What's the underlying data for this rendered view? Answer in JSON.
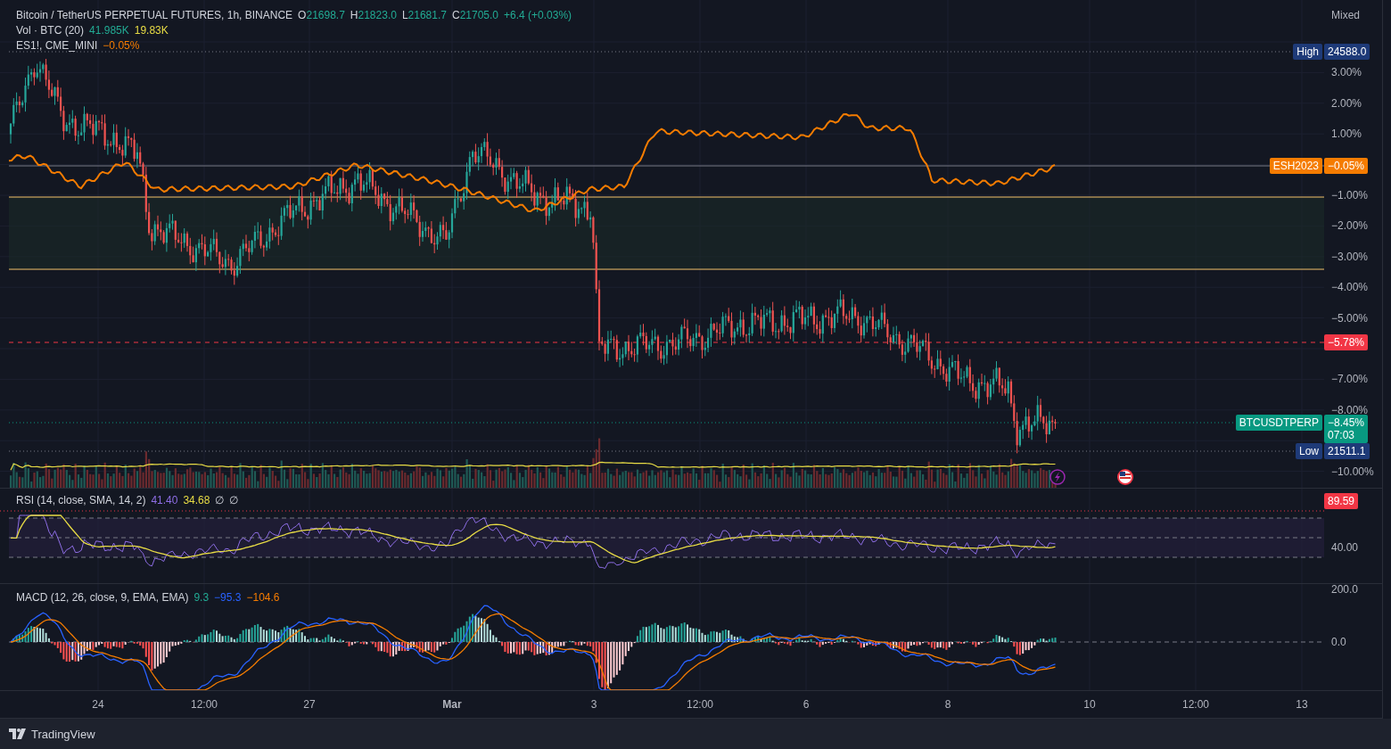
{
  "legend": {
    "symbol": "Bitcoin / TetherUS PERPETUAL FUTURES, 1h, BINANCE",
    "ohlc": [
      {
        "label": "O",
        "value": "21698.7"
      },
      {
        "label": "H",
        "value": "21823.0"
      },
      {
        "label": "L",
        "value": "21681.7"
      },
      {
        "label": "C",
        "value": "21705.0"
      }
    ],
    "change": "+6.4 (+0.03%)"
  },
  "volume_legend": {
    "label": "Vol · BTC (20)",
    "values": [
      {
        "text": "41.985K",
        "color": "#22ab94"
      },
      {
        "text": "19.83K",
        "color": "#e8dc45"
      }
    ]
  },
  "comparison_legend": {
    "label": "ES1!, CME_MINI",
    "value": "−0.05%"
  },
  "price_axis": {
    "mode": "Mixed",
    "ticks": [
      "3.00%",
      "2.00%",
      "1.00%",
      "−1.00%",
      "−2.00%",
      "−3.00%",
      "−4.00%",
      "−5.00%",
      "−7.00%",
      "−8.00%",
      "−10.00%"
    ]
  },
  "price_labels": [
    {
      "kind": "high",
      "tag": "High",
      "value": "24588.0",
      "color": "#1e3a78"
    },
    {
      "kind": "comparison",
      "tag": "ESH2023",
      "value": "−0.05%",
      "color": "#f57c00"
    },
    {
      "kind": "alert",
      "value": "−5.78%",
      "color": "#f23645"
    },
    {
      "kind": "last",
      "tag": "BTCUSDTPERP",
      "value": "−8.45%",
      "countdown": "07:03",
      "color": "#089981"
    },
    {
      "kind": "low",
      "tag": "Low",
      "value": "21511.1",
      "color": "#1e3a78"
    }
  ],
  "rsi": {
    "label": "RSI (14, close, SMA, 14, 2)",
    "values": [
      {
        "text": "41.40",
        "color": "#8e6ee6"
      },
      {
        "text": "34.68",
        "color": "#e8dc45"
      }
    ],
    "empty_values": [
      "∅",
      "∅"
    ],
    "badge": "89.59",
    "ticks": [
      "40.00"
    ]
  },
  "macd": {
    "label": "MACD (12, 26, close, 9, EMA, EMA)",
    "values": [
      {
        "text": "9.3",
        "color": "#22ab94"
      },
      {
        "text": "−95.3",
        "color": "#2962ff"
      },
      {
        "text": "−104.6",
        "color": "#f57c00"
      }
    ],
    "ticks": [
      "200.0",
      "0.0"
    ]
  },
  "time_axis": [
    {
      "label": "24",
      "bold": false
    },
    {
      "label": "12:00",
      "bold": false
    },
    {
      "label": "27",
      "bold": false
    },
    {
      "label": "Mar",
      "bold": true
    },
    {
      "label": "3",
      "bold": false
    },
    {
      "label": "12:00",
      "bold": false
    },
    {
      "label": "6",
      "bold": false
    },
    {
      "label": "8",
      "bold": false
    },
    {
      "label": "10",
      "bold": false
    },
    {
      "label": "12:00",
      "bold": false
    },
    {
      "label": "13",
      "bold": false
    }
  ],
  "footer": {
    "brand": "TradingView"
  }
}
